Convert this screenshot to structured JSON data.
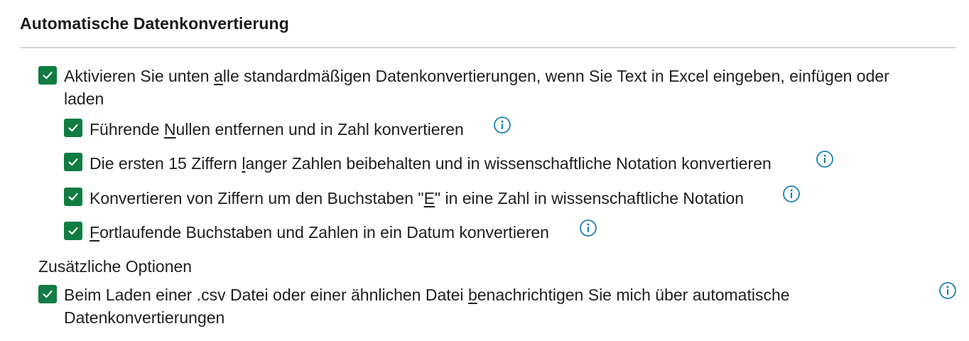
{
  "section": {
    "title": "Automatische Datenkonvertierung"
  },
  "options": {
    "enable_all": {
      "checked": true,
      "line1_a": "Aktivieren Sie unten ",
      "line1_u": "a",
      "line1_b": "lle standardmäßigen Datenkonvertierungen, wenn Sie Text in Excel eingeben, einfügen oder",
      "line2": "laden"
    },
    "leading_zeros": {
      "checked": true,
      "pre": "Führende ",
      "u": "N",
      "post": "ullen entfernen und in Zahl konvertieren"
    },
    "first_15_digits": {
      "checked": true,
      "pre": "Die ersten 15 Ziffern ",
      "u": "l",
      "post": "anger Zahlen beibehalten und in wissenschaftliche Notation konvertieren"
    },
    "letter_e": {
      "checked": true,
      "pre": "Konvertieren von Ziffern um den Buchstaben \"",
      "u": "E",
      "post": "\" in eine Zahl in wissenschaftliche Notation"
    },
    "date_convert": {
      "checked": true,
      "pre": "",
      "u": "F",
      "post": "ortlaufende Buchstaben und Zahlen in ein Datum konvertieren"
    }
  },
  "additional": {
    "title": "Zusätzliche Optionen",
    "csv_notify": {
      "checked": true,
      "line1_a": "Beim Laden einer .csv Datei oder einer ähnlichen Datei ",
      "line1_u": "b",
      "line1_b": "enachrichtigen Sie mich über automatische",
      "line2": "Datenkonvertierungen"
    }
  },
  "colors": {
    "checkbox": "#107c41",
    "info_icon": "#1a7fb5",
    "divider": "#d6d6d6"
  },
  "icons": {
    "check": "check-icon",
    "info": "info-icon"
  }
}
